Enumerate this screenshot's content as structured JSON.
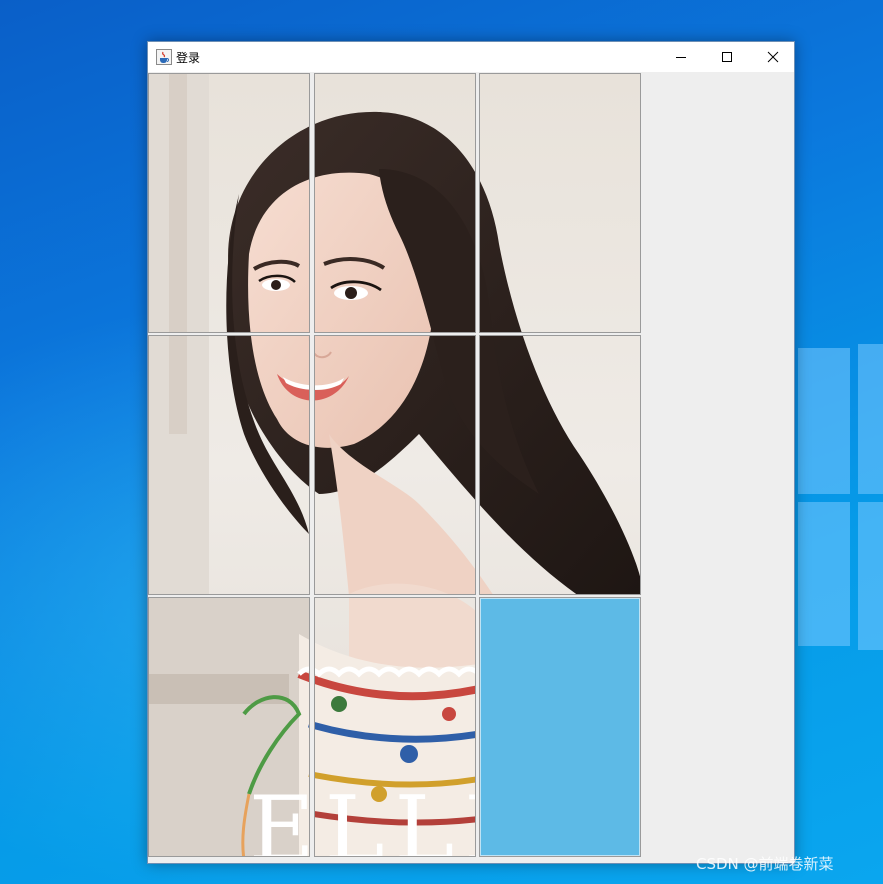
{
  "window": {
    "title": "登录",
    "icon": "java-cup-icon",
    "controls": [
      "minimize-icon",
      "maximize-icon",
      "close-icon"
    ]
  },
  "puzzle": {
    "rows": 3,
    "cols": 3,
    "tiles": [
      1,
      2,
      3,
      4,
      5,
      6,
      7,
      8,
      0
    ],
    "blank_color": "#5dbae6"
  },
  "watermark": "CSDN @前端卷新菜"
}
